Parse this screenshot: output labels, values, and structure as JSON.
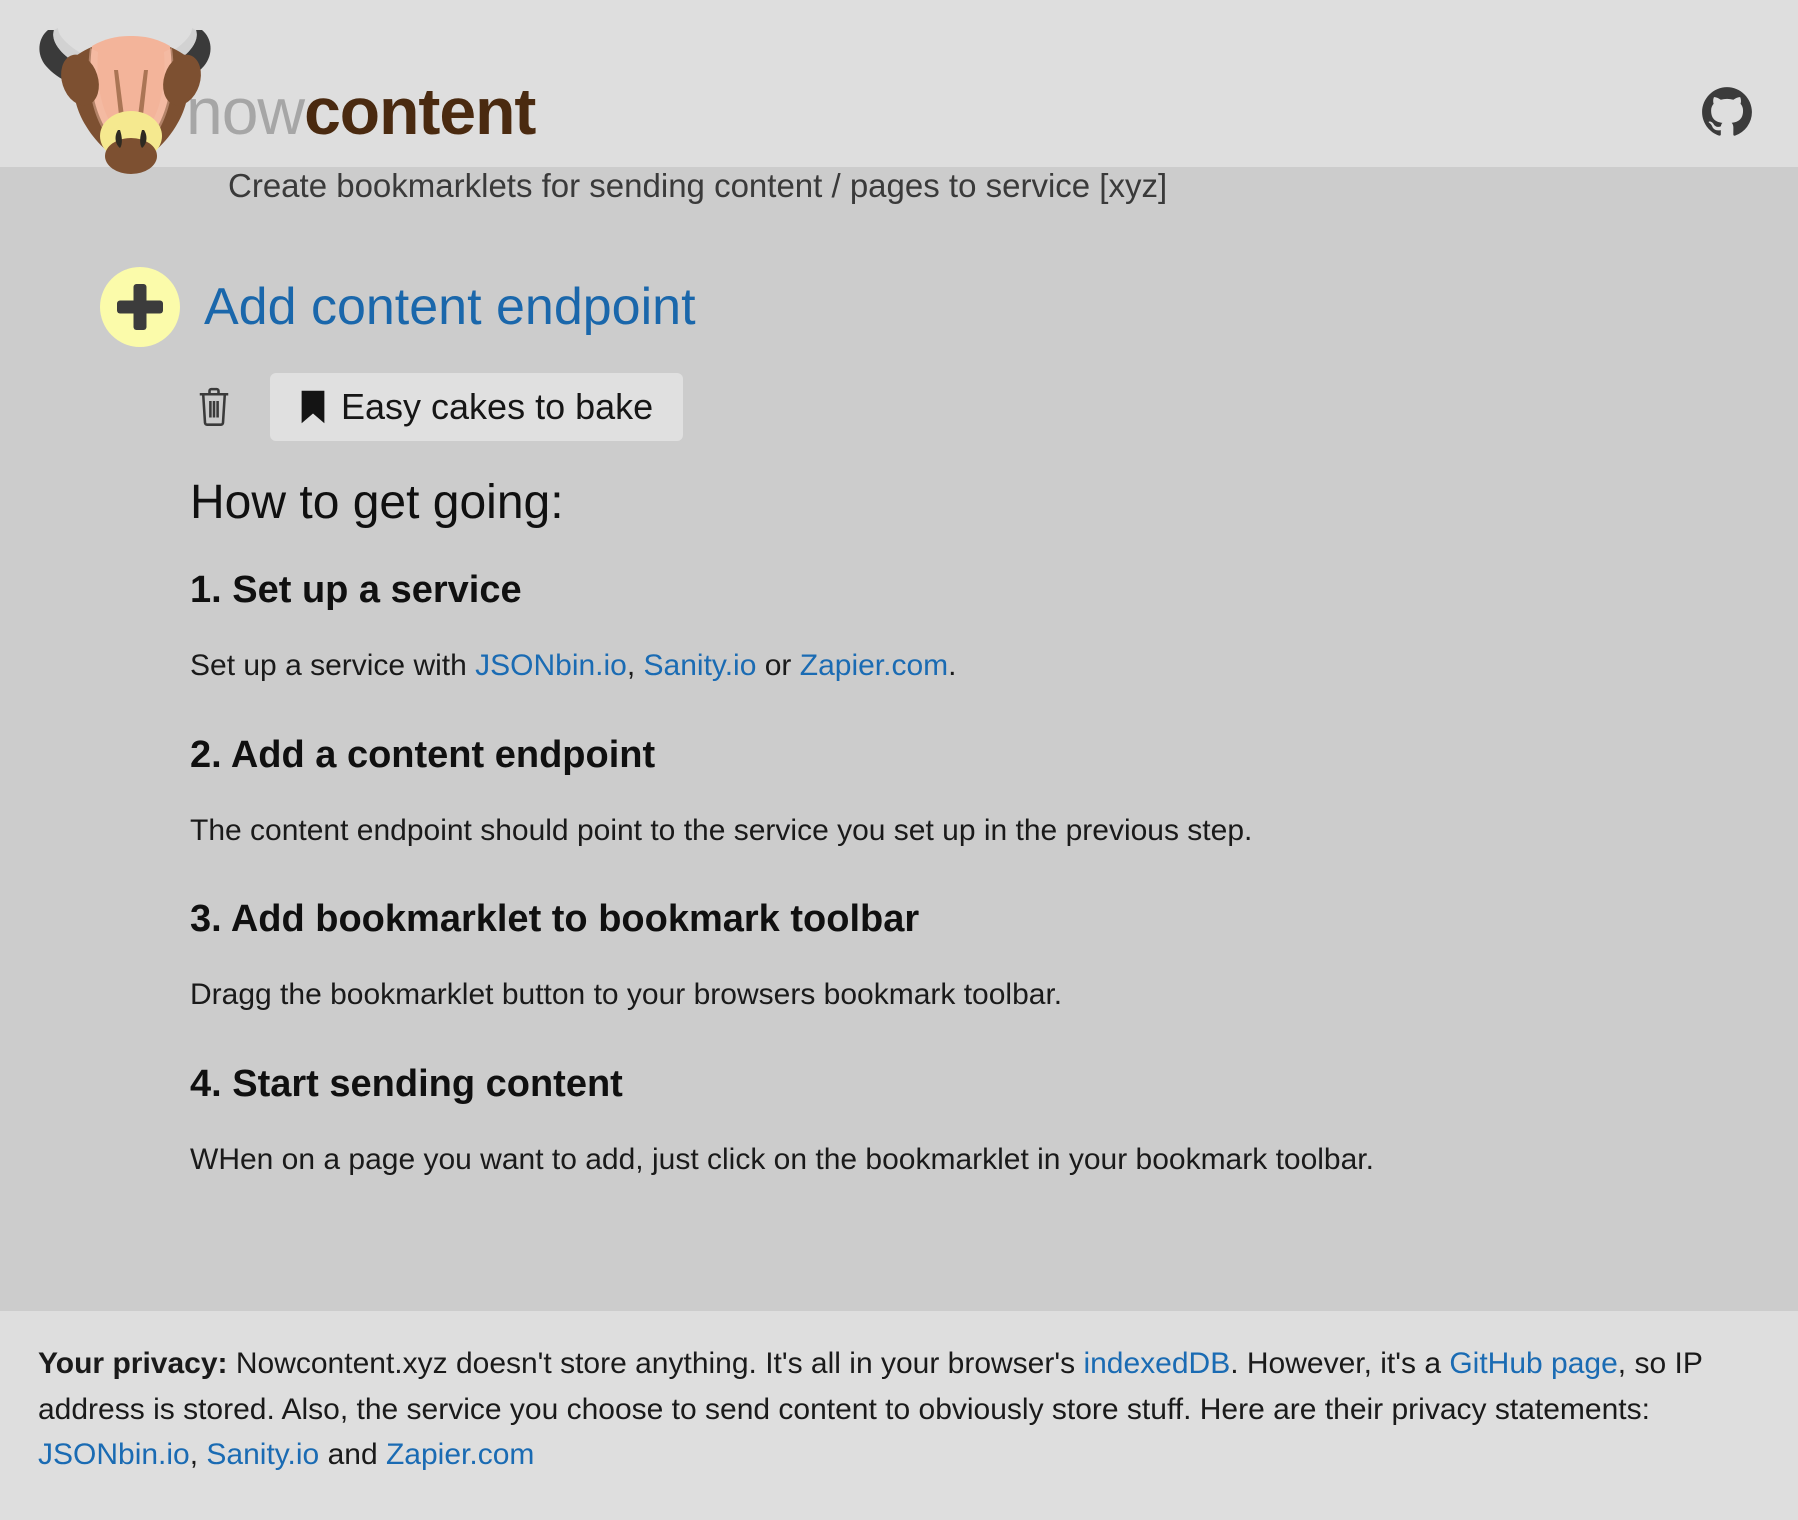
{
  "brand": {
    "logo_icon": "bull-head-logo",
    "word_prefix": "now",
    "word_suffix": "content",
    "word_prefix_color": "#a6a6a6",
    "word_suffix_color": "#4a2a10"
  },
  "header": {
    "github_icon": "github-icon",
    "tagline": "Create bookmarklets for sending content / pages to service [xyz]"
  },
  "actions": {
    "add_endpoint_label": "Add content endpoint",
    "add_endpoint_icon": "plus-icon",
    "add_endpoint_color": "#1a67ab",
    "plus_badge_color": "#fbfbaa"
  },
  "bookmarklets": [
    {
      "delete_icon": "trash-icon",
      "bookmark_icon": "bookmark-icon",
      "label": "Easy cakes to bake"
    }
  ],
  "howto": {
    "heading": "How to get going:",
    "steps": [
      {
        "title": "1. Set up a service",
        "body_pre": "Set up a service with ",
        "link1": "JSONbin.io",
        "sep1": ", ",
        "link2": "Sanity.io",
        "sep2": " or ",
        "link3": "Zapier.com",
        "body_post": "."
      },
      {
        "title": "2. Add a content endpoint",
        "body": "The content endpoint should point to the service you set up in the previous step."
      },
      {
        "title": "3. Add bookmarklet to bookmark toolbar",
        "body": "Dragg the bookmarklet button to your browsers bookmark toolbar."
      },
      {
        "title": "4. Start sending content",
        "body": "WHen on a page you want to add, just click on the bookmarklet in your bookmark toolbar."
      }
    ]
  },
  "footer": {
    "privacy_label": "Your privacy:",
    "text1": " Nowcontent.xyz doesn't store anything. It's all in your browser's ",
    "link_indexeddb": "indexedDB",
    "text2": ". However, it's a ",
    "link_github_page": "GitHub page",
    "text3": ", so IP address is stored. Also, the service you choose to send content to obviously store stuff. Here are their privacy statements: ",
    "link_jsonbin": "JSONbin.io",
    "text4": ", ",
    "link_sanity": "Sanity.io",
    "text5": " and ",
    "link_zapier": "Zapier.com"
  },
  "colors": {
    "header_bg": "#dedede",
    "body_bg": "#cccccc",
    "footer_bg": "#dedede",
    "link": "#1a6bb3"
  }
}
